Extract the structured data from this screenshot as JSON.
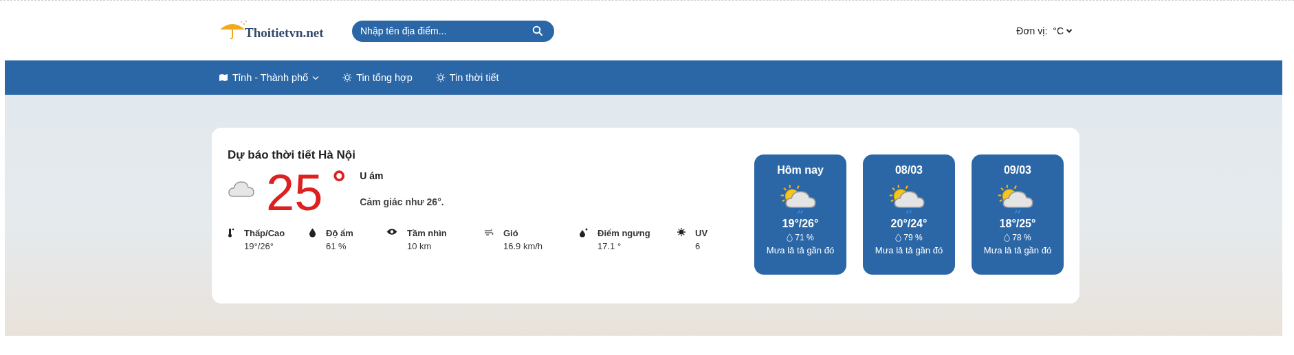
{
  "logo": {
    "text": "Thoitietvn.net"
  },
  "search": {
    "placeholder": "Nhập tên địa điểm..."
  },
  "unit": {
    "label": "Đơn vị:",
    "value": "°C"
  },
  "nav": [
    {
      "label": "Tỉnh - Thành phố",
      "kind": "map",
      "dropdown": true
    },
    {
      "label": "Tin tổng hợp",
      "kind": "sun",
      "dropdown": false
    },
    {
      "label": "Tin thời tiết",
      "kind": "sun",
      "dropdown": false
    }
  ],
  "current": {
    "title": "Dự báo thời tiết Hà Nội",
    "temperature": "25",
    "degree": "°",
    "condition": "U ám",
    "feels_like": "Cảm giác như 26°.",
    "metrics": [
      {
        "kind": "thermometer",
        "label": "Thấp/Cao",
        "value": "19°/26°"
      },
      {
        "kind": "humidity",
        "label": "Độ ẩm",
        "value": "61 %"
      },
      {
        "kind": "visibility",
        "label": "Tầm nhìn",
        "value": "10 km"
      },
      {
        "kind": "wind",
        "label": "Gió",
        "value": "16.9 km/h"
      },
      {
        "kind": "dewpoint",
        "label": "Điểm ngưng",
        "value": "17.1 °"
      },
      {
        "kind": "uv",
        "label": "UV",
        "value": "6"
      }
    ]
  },
  "forecast": [
    {
      "day": "Hôm nay",
      "temps": "19°/26°",
      "humidity": "71 %",
      "description": "Mưa lả tả gần đó"
    },
    {
      "day": "08/03",
      "temps": "20°/24°",
      "humidity": "79 %",
      "description": "Mưa lả tả gần đó"
    },
    {
      "day": "09/03",
      "temps": "18°/25°",
      "humidity": "78 %",
      "description": "Mưa lả tả gần đó"
    }
  ]
}
